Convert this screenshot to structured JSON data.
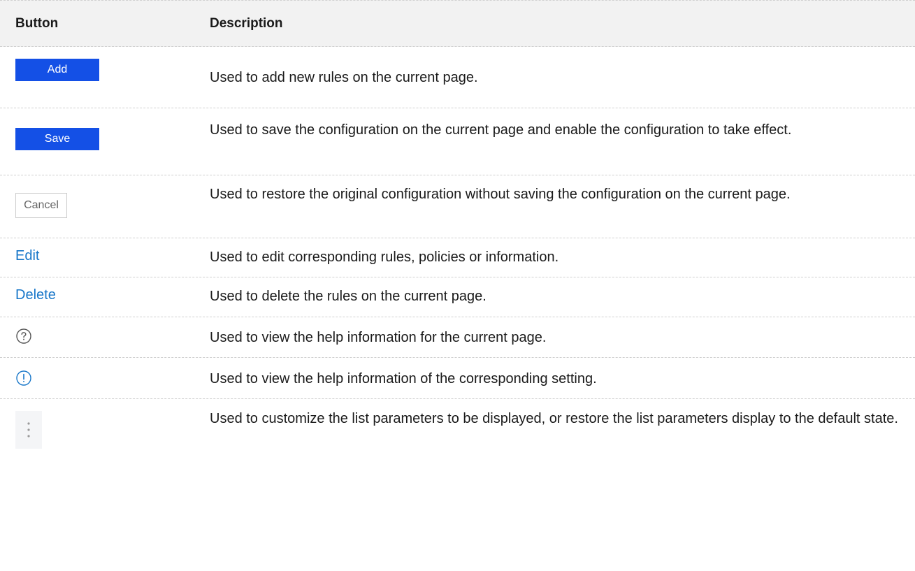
{
  "header": {
    "button": "Button",
    "description": "Description"
  },
  "rows": [
    {
      "button": "Add",
      "description": "Used to add new rules on the current page."
    },
    {
      "button": "Save",
      "description": "Used to save the configuration on the current page and enable the configuration to take effect."
    },
    {
      "button": "Cancel",
      "description": "Used to restore the original configuration without saving the configuration on the current page."
    },
    {
      "button": "Edit",
      "description": "Used to edit corresponding rules, policies or information."
    },
    {
      "button": "Delete",
      "description": "Used to delete the rules on the current page."
    },
    {
      "icon": "help-icon",
      "description": "Used to view the help information for the current page."
    },
    {
      "icon": "info-icon",
      "description": "Used to view the help information of the corresponding setting."
    },
    {
      "icon": "more-icon",
      "description": "Used to customize the list parameters to be displayed, or restore the list parameters display to the default state."
    }
  ],
  "colors": {
    "primary_button": "#1450e6",
    "link": "#1877c9",
    "header_bg": "#f2f2f2"
  }
}
